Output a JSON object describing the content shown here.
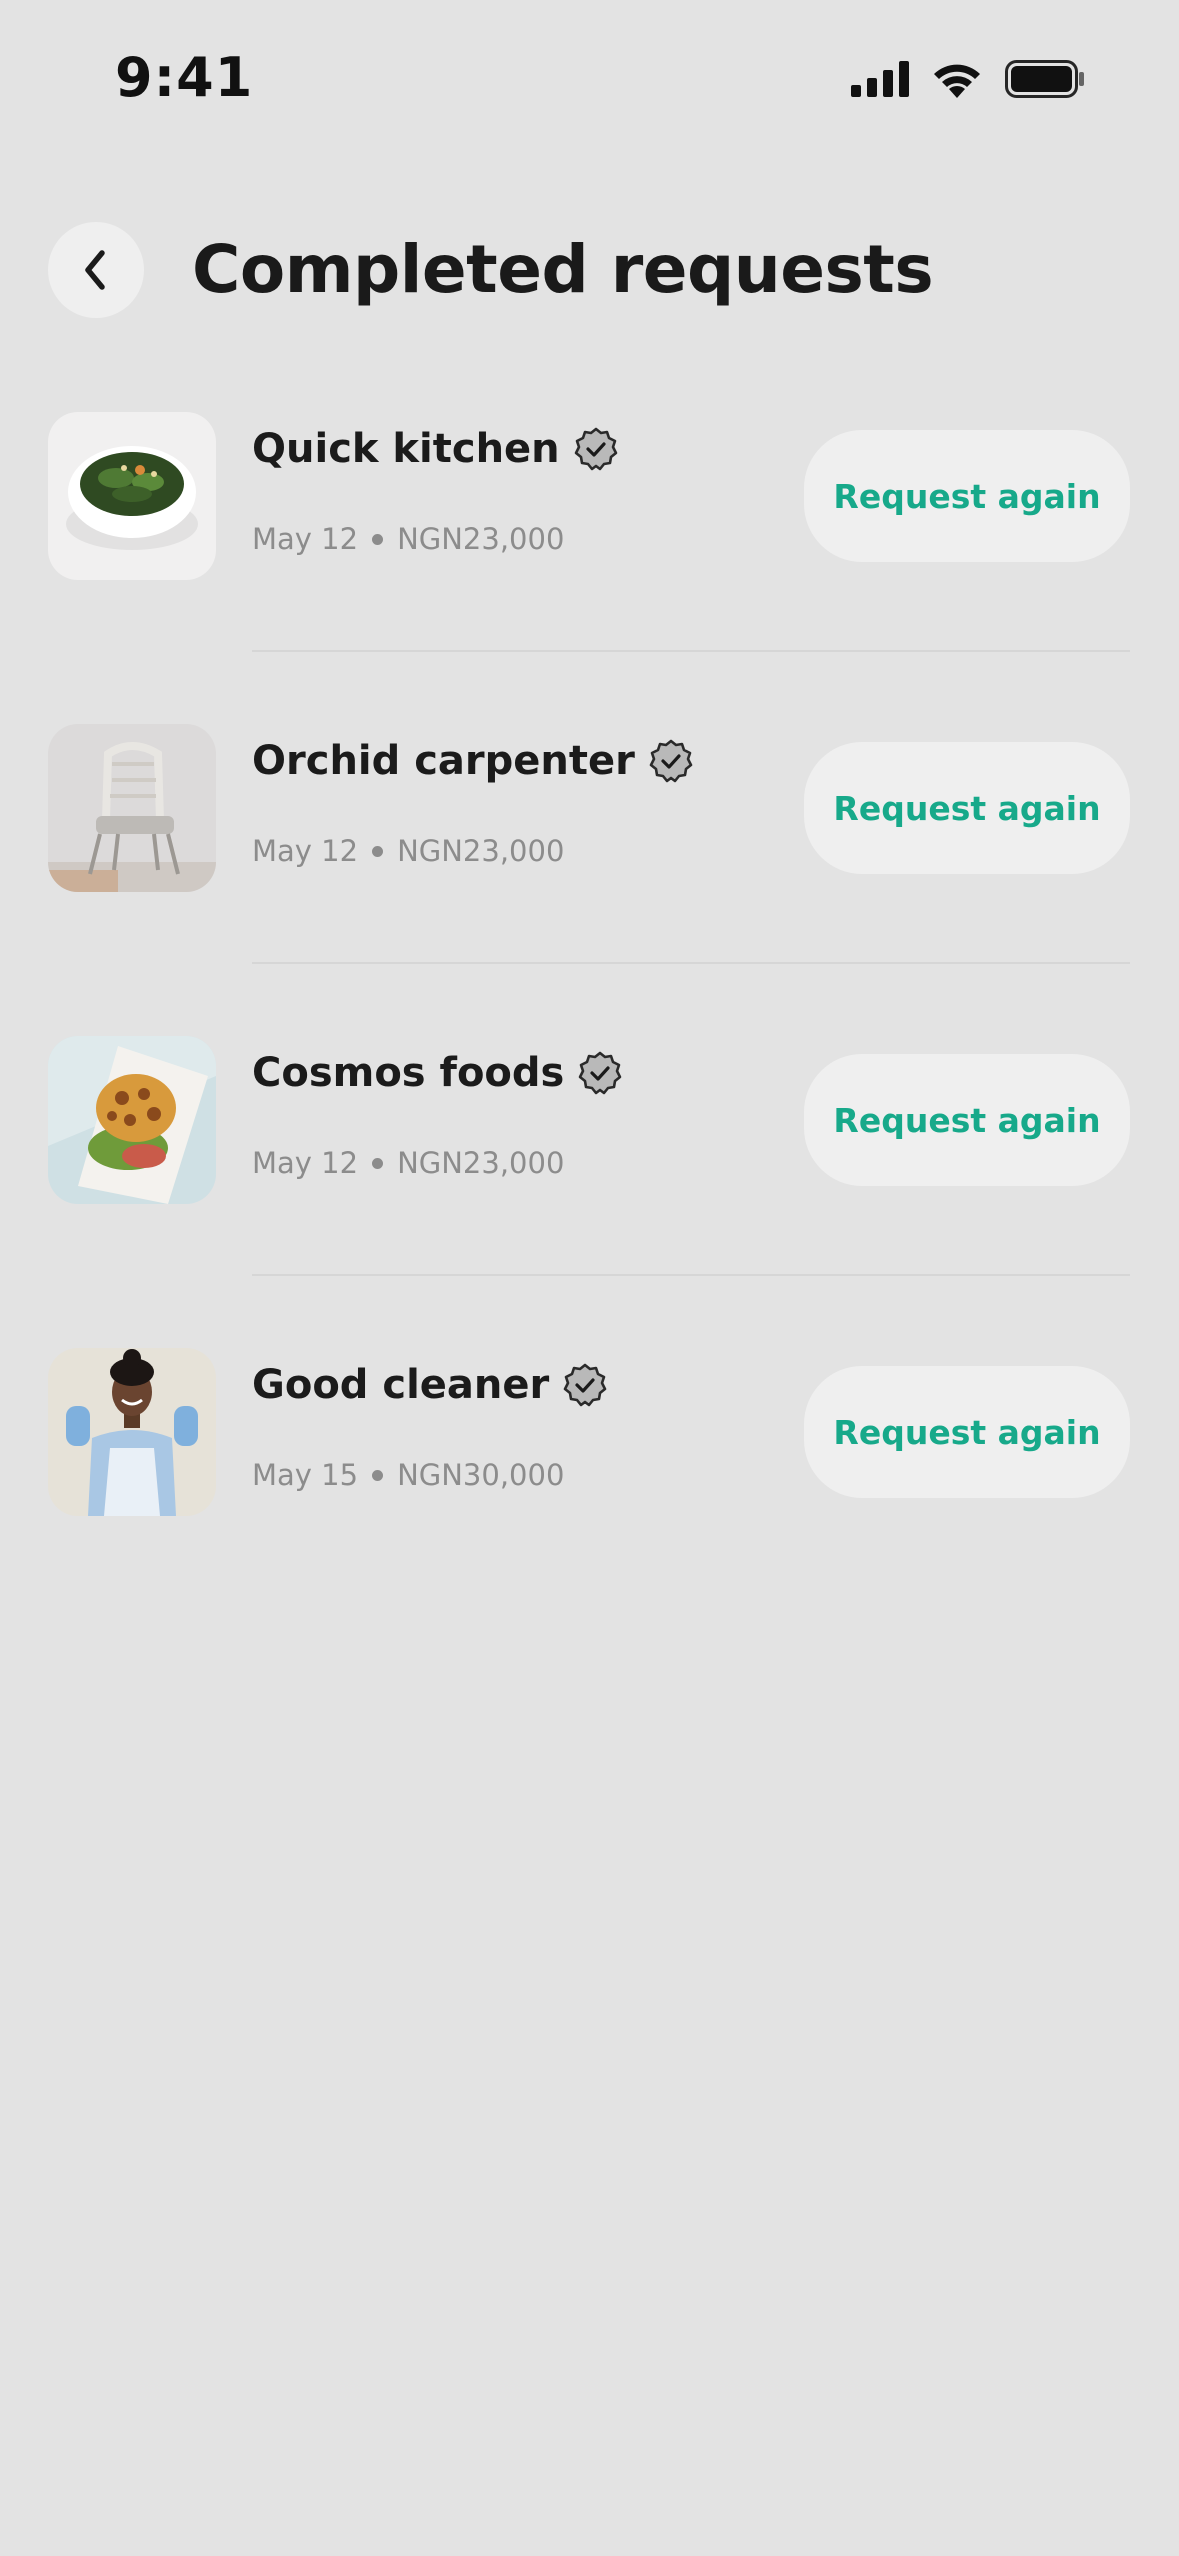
{
  "status_bar": {
    "time": "9:41",
    "icons": [
      "signal-icon",
      "wifi-icon",
      "battery-icon"
    ]
  },
  "header": {
    "back_icon": "chevron-left-icon",
    "title": "Completed requests"
  },
  "colors": {
    "background": "#e3e3e3",
    "accent": "#17a98a",
    "button_bg": "#efefef",
    "muted_text": "#8c8c8c"
  },
  "requests": [
    {
      "name": "Quick kitchen",
      "verified_icon": "verified-badge-icon",
      "date": "May 12",
      "amount": "NGN23,000",
      "action": "Request again",
      "image": "salad-bowl-photo"
    },
    {
      "name": "Orchid carpenter",
      "verified_icon": "verified-badge-icon",
      "date": "May 12",
      "amount": "NGN23,000",
      "action": "Request again",
      "image": "chair-photo"
    },
    {
      "name": "Cosmos foods",
      "verified_icon": "verified-badge-icon",
      "date": "May 12",
      "amount": "NGN23,000",
      "action": "Request again",
      "image": "burger-plate-photo"
    },
    {
      "name": "Good cleaner",
      "verified_icon": "verified-badge-icon",
      "date": "May 15",
      "amount": "NGN30,000",
      "action": "Request again",
      "image": "cleaner-person-photo"
    }
  ]
}
